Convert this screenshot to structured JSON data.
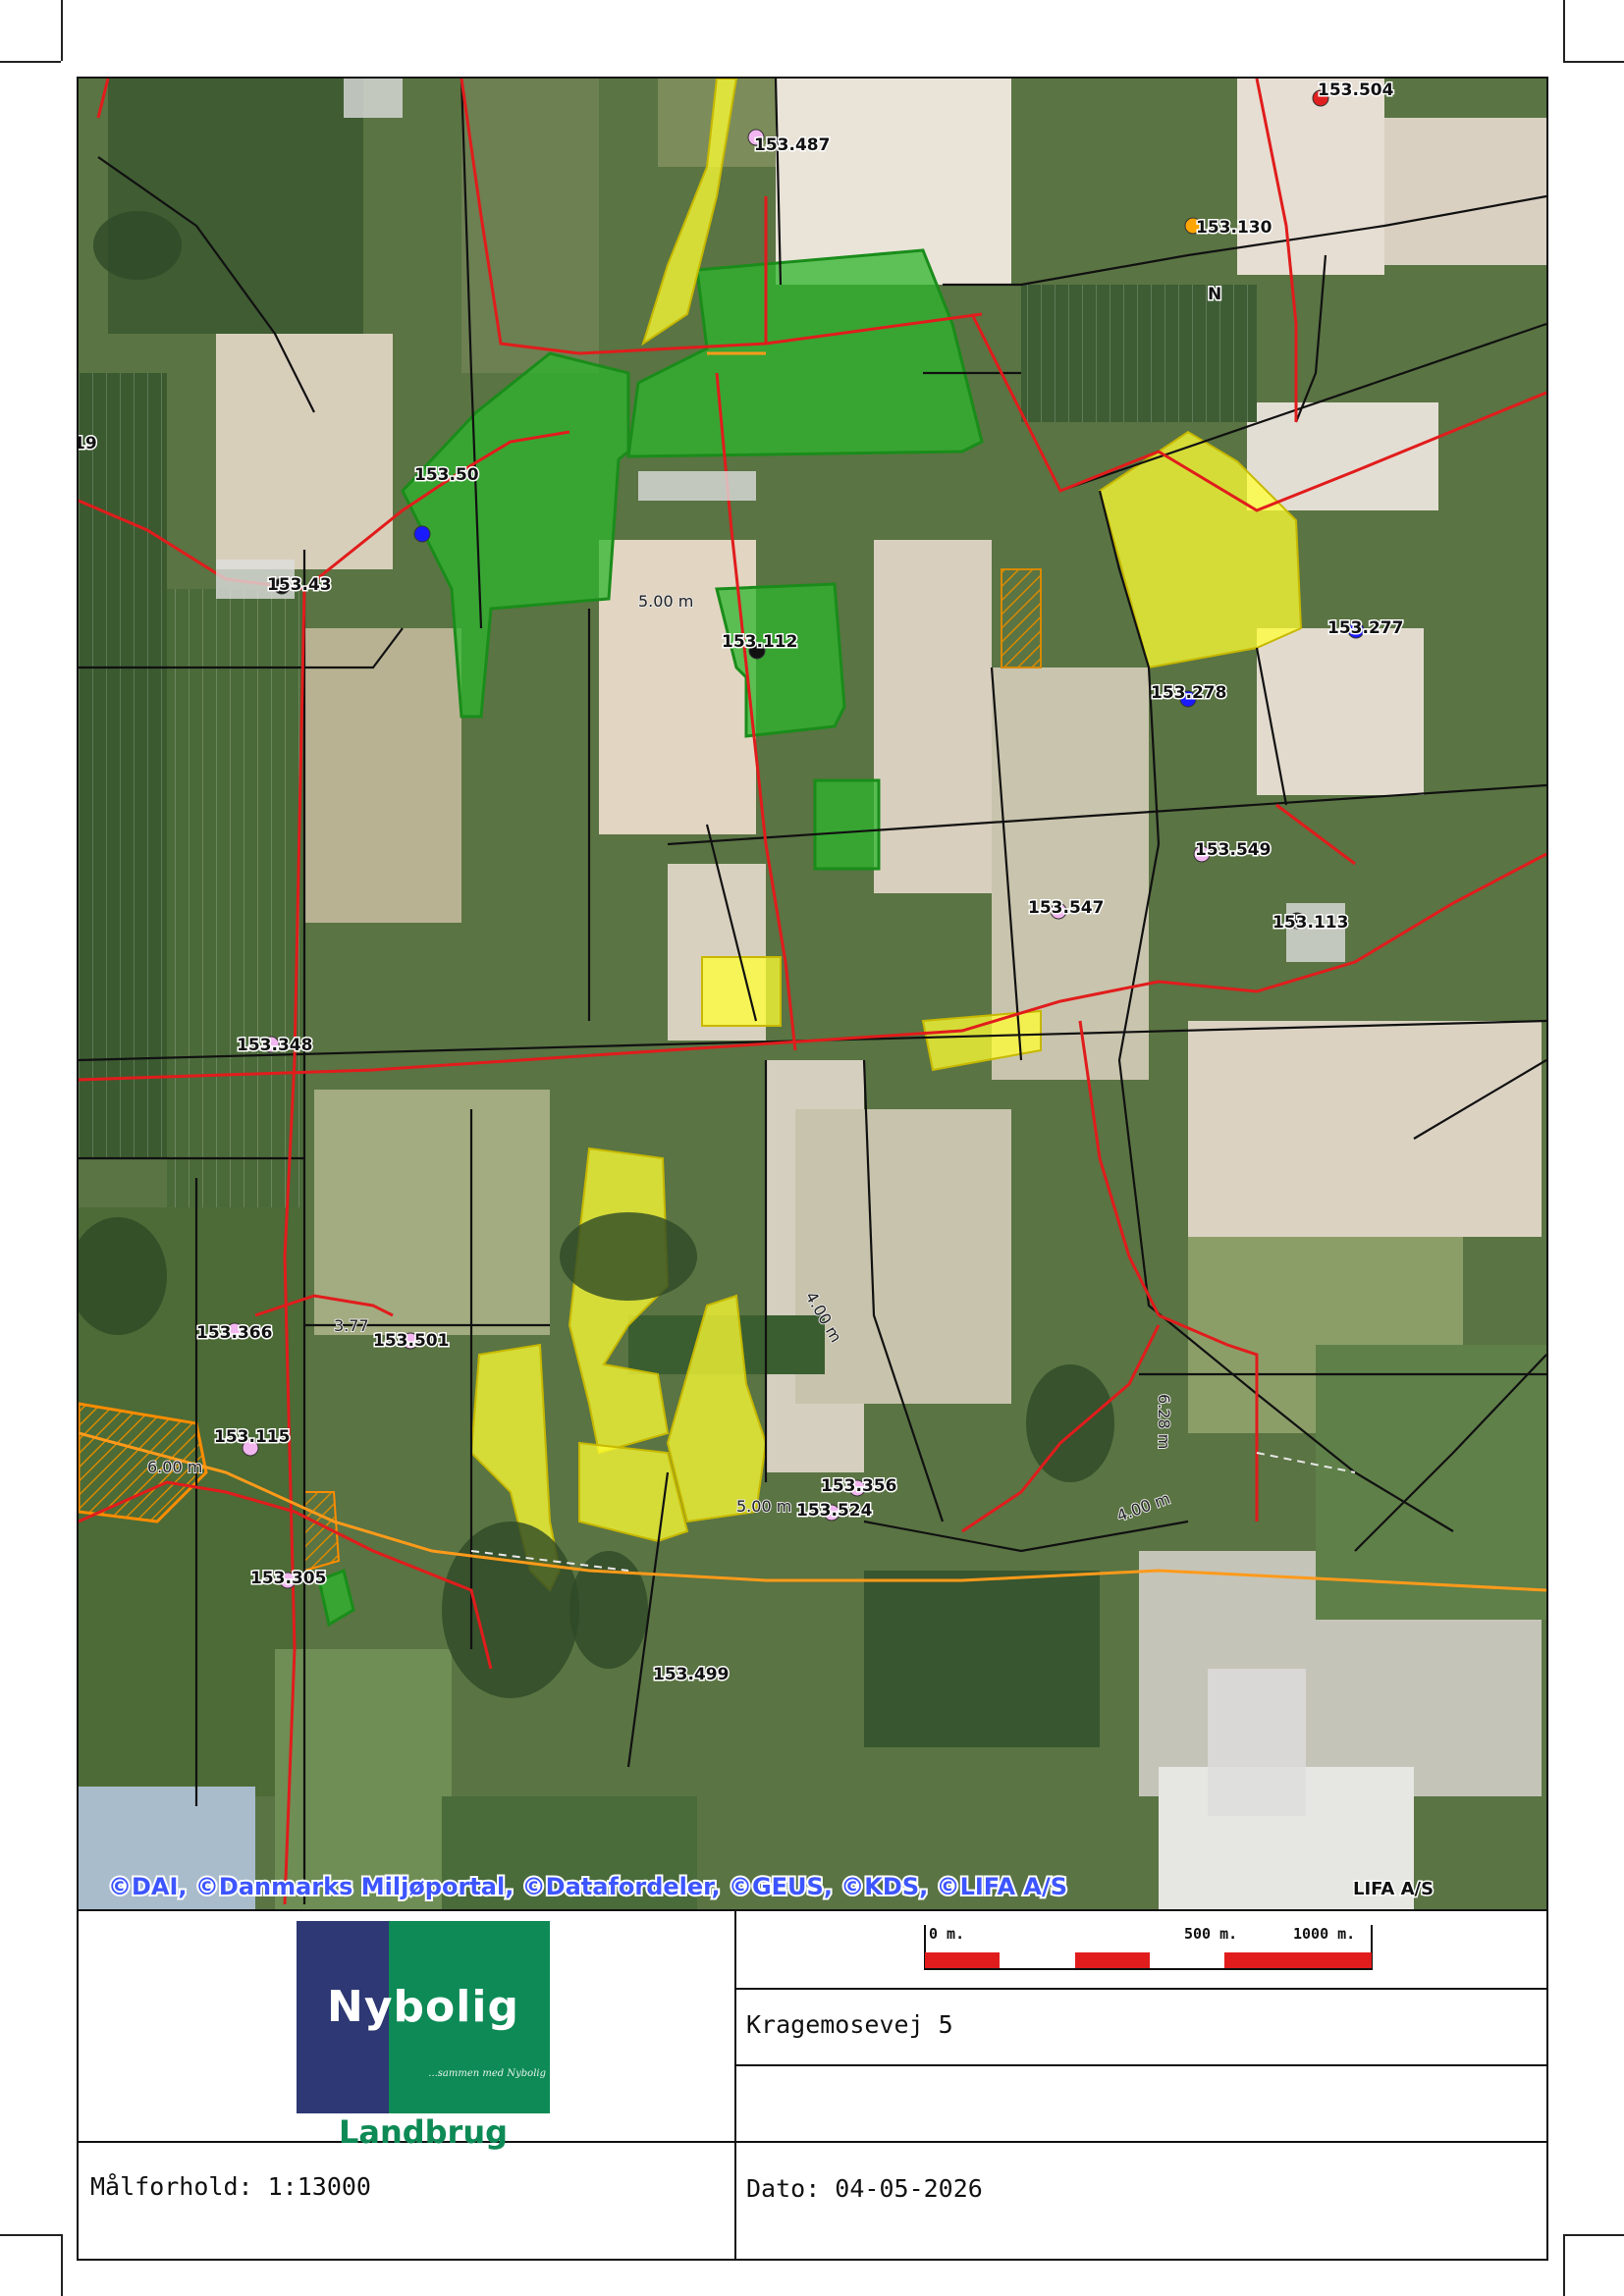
{
  "map": {
    "copyright": "©DAI, ©Danmarks Miljøportal, ©Datafordeler, ©GEUS, ©KDS, ©LIFA A/S",
    "copyright_right": "LIFA A/S",
    "north_label": "N",
    "points": [
      {
        "label": "153.504",
        "color": "#e02020"
      },
      {
        "label": "153.487",
        "color": "#f2b6f0"
      },
      {
        "label": "153.130",
        "color": "#ffa500"
      },
      {
        "label": "19",
        "color": ""
      },
      {
        "label": "153.50",
        "color": "#1a1aff"
      },
      {
        "label": "153.43",
        "color": "#111111"
      },
      {
        "label": "153.112",
        "color": "#111111"
      },
      {
        "label": "153.277",
        "color": "#1a1aff"
      },
      {
        "label": "153.278",
        "color": "#1a1aff"
      },
      {
        "label": "153.549",
        "color": "#f2b6f0"
      },
      {
        "label": "153.547",
        "color": "#f2b6f0"
      },
      {
        "label": "153.113",
        "color": "#111111"
      },
      {
        "label": "153.348",
        "color": "#f2b6f0"
      },
      {
        "label": "153.366",
        "color": "#f2b6f0"
      },
      {
        "label": "153.501",
        "color": "#f2b6f0"
      },
      {
        "label": "153.115",
        "color": "#f2b6f0"
      },
      {
        "label": "153.356",
        "color": "#f2b6f0"
      },
      {
        "label": "153.524",
        "color": "#f2b6f0"
      },
      {
        "label": "153.305",
        "color": "#f2b6f0"
      },
      {
        "label": "153.499",
        "color": ""
      }
    ],
    "distances": [
      "5.00 m",
      "3.77",
      "6.28 m",
      "4.00 m",
      "5.00 m",
      "4.00 m",
      "6.00 m"
    ]
  },
  "title_block": {
    "logo_word": "Nybolig",
    "logo_tagline": "...sammen med Nybolig",
    "logo_sub": "Landbrug",
    "scale_labels": [
      "0 m.",
      "500 m.",
      "1000 m."
    ],
    "address": "Kragemosevej 5",
    "scale_ratio": "Målforhold: 1:13000",
    "date": "Dato: 04-05-2026"
  }
}
